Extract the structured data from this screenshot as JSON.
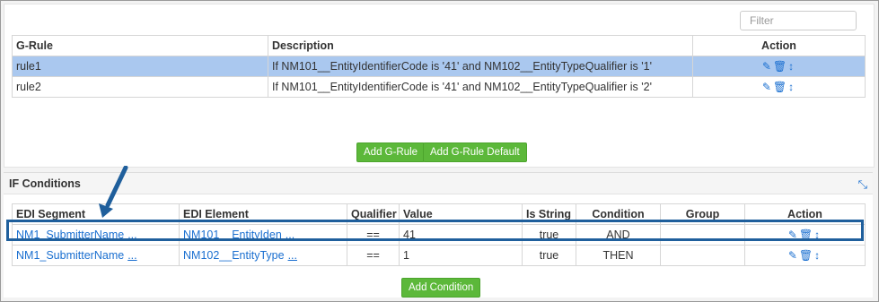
{
  "filter": {
    "placeholder": "Filter"
  },
  "grules": {
    "headers": {
      "rule": "G-Rule",
      "description": "Description",
      "action": "Action"
    },
    "rows": [
      {
        "rule": "rule1",
        "description": "If NM101__EntityIdentifierCode is '41' and NM102__EntityTypeQualifier is '1'",
        "selected": true
      },
      {
        "rule": "rule2",
        "description": "If NM101__EntityIdentifierCode is '41' and NM102__EntityTypeQualifier is '2'",
        "selected": false
      }
    ],
    "buttons": {
      "add": "Add G-Rule",
      "add_default": "Add G-Rule Default"
    }
  },
  "conditions": {
    "title": "IF Conditions",
    "headers": {
      "segment": "EDI Segment",
      "element": "EDI Element",
      "qualifier": "Qualifier",
      "value": "Value",
      "is_string": "Is String",
      "condition": "Condition",
      "group": "Group",
      "action": "Action"
    },
    "rows": [
      {
        "segment": "NM1_SubmitterName",
        "element": "NM101__EntityIden",
        "qualifier": "==",
        "value": "41",
        "is_string": "true",
        "condition": "AND",
        "group": ""
      },
      {
        "segment": "NM1_SubmitterName",
        "element": "NM102__EntityType",
        "qualifier": "==",
        "value": "1",
        "is_string": "true",
        "condition": "THEN",
        "group": ""
      }
    ],
    "ellipsis": "...",
    "button": "Add Condition"
  },
  "icons": {
    "edit": "pencil-icon",
    "delete": "trash-icon",
    "move": "arrows-vertical-icon",
    "pin": "pin-icon"
  },
  "colors": {
    "accent": "#1a6fd0",
    "selected_row": "#aac8ef",
    "button_green": "#5cb83a",
    "highlight_box": "#1f5f9c"
  }
}
